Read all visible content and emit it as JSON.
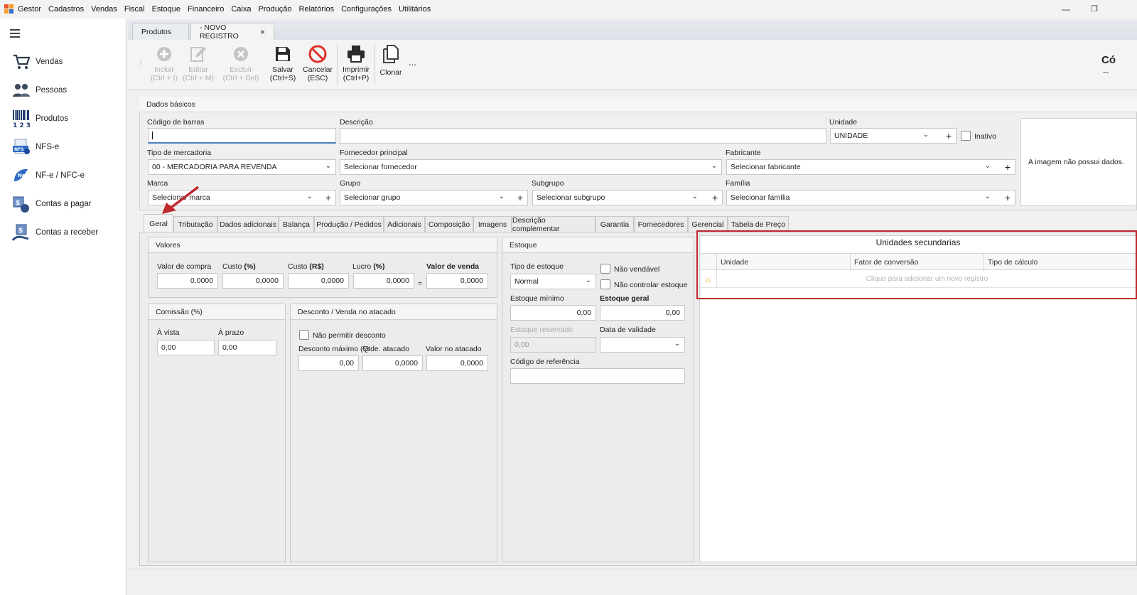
{
  "menubar": {
    "items": [
      "Gestor",
      "Cadastros",
      "Vendas",
      "Fiscal",
      "Estoque",
      "Financeiro",
      "Caixa",
      "Produção",
      "Relatórios",
      "Configurações",
      "Utilitários"
    ]
  },
  "sidebar": {
    "items": [
      {
        "label": "Vendas",
        "icon": "cart-icon"
      },
      {
        "label": "Pessoas",
        "icon": "people-icon"
      },
      {
        "label": "Produtos",
        "icon": "barcode-icon"
      },
      {
        "label": "NFS-e",
        "icon": "nfse-icon"
      },
      {
        "label": "NF-e / NFC-e",
        "icon": "nfe-icon"
      },
      {
        "label": "Contas a pagar",
        "icon": "pay-icon"
      },
      {
        "label": "Contas a receber",
        "icon": "receive-icon"
      }
    ]
  },
  "doc_tabs": [
    "Produtos",
    "- NOVO REGISTRO"
  ],
  "toolbar": {
    "incluir": [
      "Incluir",
      "(Ctrl + I)"
    ],
    "editar": [
      "Editar",
      "(Ctrl + M)"
    ],
    "excluir": [
      "Excluir",
      "(Ctrl + Del)"
    ],
    "salvar": [
      "Salvar",
      "(Ctrl+S)"
    ],
    "cancelar": [
      "Cancelar",
      "(ESC)"
    ],
    "imprimir": [
      "Imprimir",
      "(Ctrl+P)"
    ],
    "clonar": "Clonar",
    "more": "...",
    "code_title": "Có",
    "code_value": "--"
  },
  "dados": {
    "title": "Dados básicos",
    "codigo_barras": {
      "label": "Código de barras",
      "value": ""
    },
    "descricao": {
      "label": "Descrição",
      "value": ""
    },
    "unidade": {
      "label": "Unidade",
      "value": "UNIDADE"
    },
    "inativo": "Inativo",
    "tipo_mercadoria": {
      "label": "Tipo de mercadoria",
      "value": "00 - MERCADORIA PARA REVENDA"
    },
    "fornecedor": {
      "label": "Fornecedor principal",
      "value": "Selecionar fornecedor"
    },
    "fabricante": {
      "label": "Fabricante",
      "value": "Selecionar fabricante"
    },
    "marca": {
      "label": "Marca",
      "value": "Selecionar marca"
    },
    "grupo": {
      "label": "Grupo",
      "value": "Selecionar grupo"
    },
    "subgrupo": {
      "label": "Subgrupo",
      "value": "Selecionar subgrupo"
    },
    "familia": {
      "label": "Família",
      "value": "Selecionar família"
    },
    "imagem": "A imagem não possui dados."
  },
  "tabs": [
    "Geral",
    "Tributação",
    "Dados adicionais",
    "Balança",
    "Produção / Pedidos",
    "Adicionais",
    "Composição",
    "Imagens",
    "Descrição complementar",
    "Garantia",
    "Fornecedores",
    "Gerencial",
    "Tabela de Preço"
  ],
  "valores": {
    "title": "Valores",
    "valor_compra": {
      "label": "Valor de compra",
      "value": "0,0000"
    },
    "custo_pct": {
      "label": "Custo",
      "suffix": "(%)",
      "value": "0,0000"
    },
    "custo_rs": {
      "label": "Custo",
      "suffix": "(R$)",
      "value": "0,0000"
    },
    "lucro": {
      "label": "Lucro",
      "suffix": "(%)",
      "value": "0,0000"
    },
    "equals": "=",
    "valor_venda": {
      "label": "Valor de venda",
      "value": "0,0000"
    }
  },
  "comissao": {
    "title": "Comissão (%)",
    "a_vista": {
      "label": "À vista",
      "value": "0,00"
    },
    "a_prazo": {
      "label": "À prazo",
      "value": "0,00"
    }
  },
  "desconto": {
    "title": "Desconto / Venda no atacado",
    "nao_permitir": "Não permitir desconto",
    "desc_max": {
      "label": "Desconto máximo (%",
      "value": "0,00"
    },
    "qtde": {
      "label": "Qtde. atacado",
      "value": "0,0000"
    },
    "valor_atacado": {
      "label": "Valor no atacado",
      "value": "0,0000"
    }
  },
  "estoque": {
    "title": "Estoque",
    "tipo": {
      "label": "Tipo de estoque",
      "value": "Normal"
    },
    "nao_vendavel": "Não vendável",
    "nao_controlar": "Não controlar estoque",
    "minimo": {
      "label": "Estoque mínimo",
      "value": "0,00"
    },
    "geral": {
      "label": "Estoque geral",
      "value": "0,00"
    },
    "reservado": {
      "label": "Estoque reservado",
      "value": "0,00"
    },
    "validade": {
      "label": "Data de validade",
      "value": ""
    },
    "referencia": {
      "label": "Código de referência",
      "value": ""
    }
  },
  "unidades": {
    "title": "Unidades secundarias",
    "columns": [
      "Unidade",
      "Fator de conversão",
      "Tipo de cálculo"
    ],
    "new_row": "Clique para adicionar um novo registro"
  },
  "colors": {
    "accent": "#4a7fc0",
    "highlight": "#c0282d"
  }
}
